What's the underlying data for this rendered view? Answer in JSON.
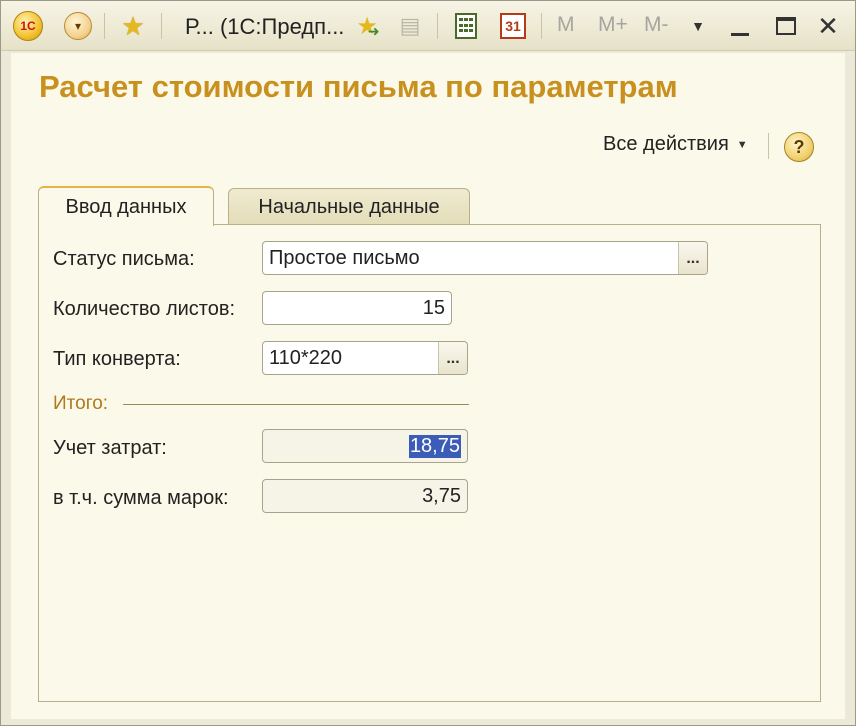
{
  "titlebar": {
    "logo_text": "1С",
    "window_title": "Р...  (1С:Предп...",
    "memory_buttons": [
      "M",
      "M+",
      "M-"
    ],
    "calendar_day": "31",
    "icons": [
      "1c-logo-icon",
      "dropdown-menu-icon",
      "favorite-star-icon",
      "add-to-favorites-icon",
      "document-icon",
      "calculator-icon",
      "calendar-icon",
      "minimize-icon",
      "maximize-icon",
      "close-icon"
    ]
  },
  "form": {
    "title": "Расчет стоимости письма по параметрам",
    "all_actions_label": "Все действия",
    "help_label": "?"
  },
  "tabs": [
    {
      "label": "Ввод данных",
      "active": true
    },
    {
      "label": "Начальные данные",
      "active": false
    }
  ],
  "fields": {
    "status": {
      "label": "Статус письма:",
      "value": "Простое письмо"
    },
    "sheets": {
      "label": "Количество листов:",
      "value": "15"
    },
    "envelope": {
      "label": "Тип конверта:",
      "value": "110*220"
    },
    "total_group": {
      "label": "Итого:"
    },
    "cost": {
      "label": "Учет затрат:",
      "value": "18,75"
    },
    "stamps": {
      "label": "в т.ч. сумма марок:",
      "value": "3,75"
    }
  },
  "pick_button_label": "..."
}
